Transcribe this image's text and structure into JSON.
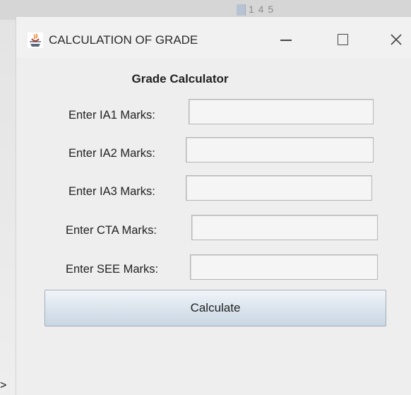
{
  "background": {
    "text": "1 4 5"
  },
  "window": {
    "title": "CALCULATION OF GRADE",
    "controls": {
      "minimize": "—",
      "maximize": "□",
      "close": "X"
    }
  },
  "form": {
    "heading": "Grade Calculator",
    "fields": [
      {
        "label": "Enter IA1 Marks:",
        "value": ""
      },
      {
        "label": "Enter IA2 Marks:",
        "value": ""
      },
      {
        "label": "Enter IA3 Marks:",
        "value": ""
      },
      {
        "label": "Enter CTA Marks:",
        "value": ""
      },
      {
        "label": "Enter SEE Marks:",
        "value": ""
      }
    ],
    "button_label": "Calculate"
  },
  "page_edge_glyph": ">",
  "colors": {
    "window_bg": "#eeeeee",
    "button_gradient_top": "#f1f5f9",
    "button_gradient_bottom": "#c9d6e2",
    "field_border": "#b5b5b5"
  },
  "icons": {
    "app": "java-cup-icon",
    "minimize": "minimize-icon",
    "maximize": "maximize-icon",
    "close": "close-icon"
  }
}
